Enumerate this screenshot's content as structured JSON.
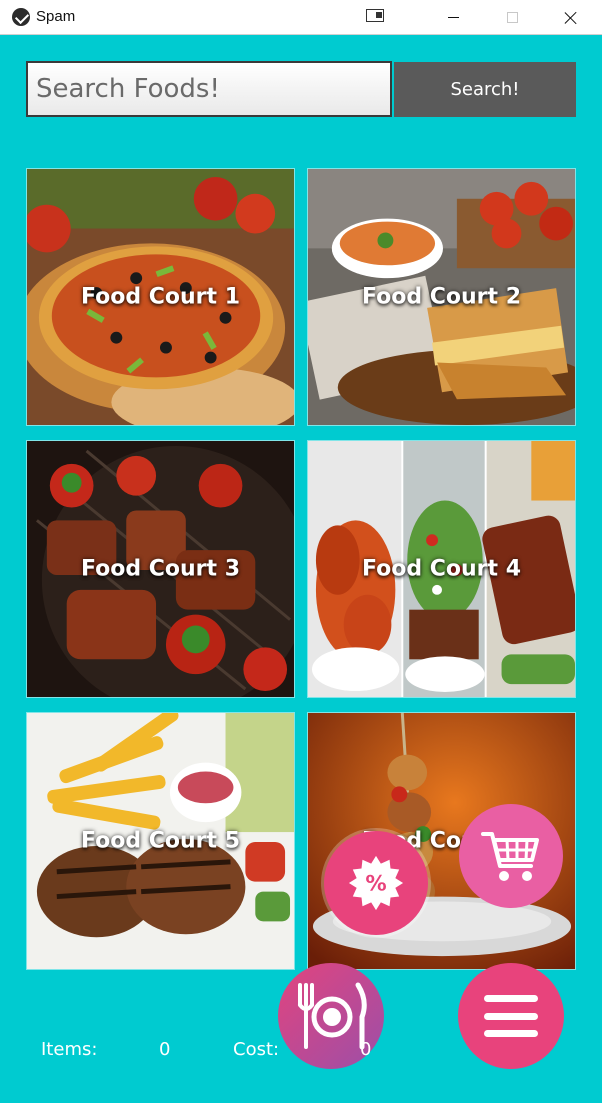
{
  "window": {
    "title": "Spam",
    "icons": [
      "app-icon",
      "snap-icon",
      "minimize-icon",
      "maximize-icon",
      "close-icon"
    ]
  },
  "search": {
    "placeholder": "Search Foods!",
    "value": "",
    "button_label": "Search!"
  },
  "food_courts": [
    {
      "label": "Food Court 1"
    },
    {
      "label": "Food Court 2"
    },
    {
      "label": "Food Court 3"
    },
    {
      "label": "Food Court 4"
    },
    {
      "label": "Food Court 5"
    },
    {
      "label": "Food Court 6"
    }
  ],
  "footer": {
    "items_label": "Items:",
    "items_count": "0",
    "cost_label": "Cost:",
    "cost_value": "0"
  },
  "fabs": {
    "discount_icon": "discount-icon",
    "cart_icon": "cart-icon",
    "dining_icon": "dining-icon",
    "menu_icon": "menu-icon"
  },
  "colors": {
    "background": "#00cbd0",
    "search_button": "#5a5a5a",
    "fab_pink": "#e8437c",
    "fab_light_pink": "#e95fa3",
    "fab_purple": "#9c4fa8"
  }
}
